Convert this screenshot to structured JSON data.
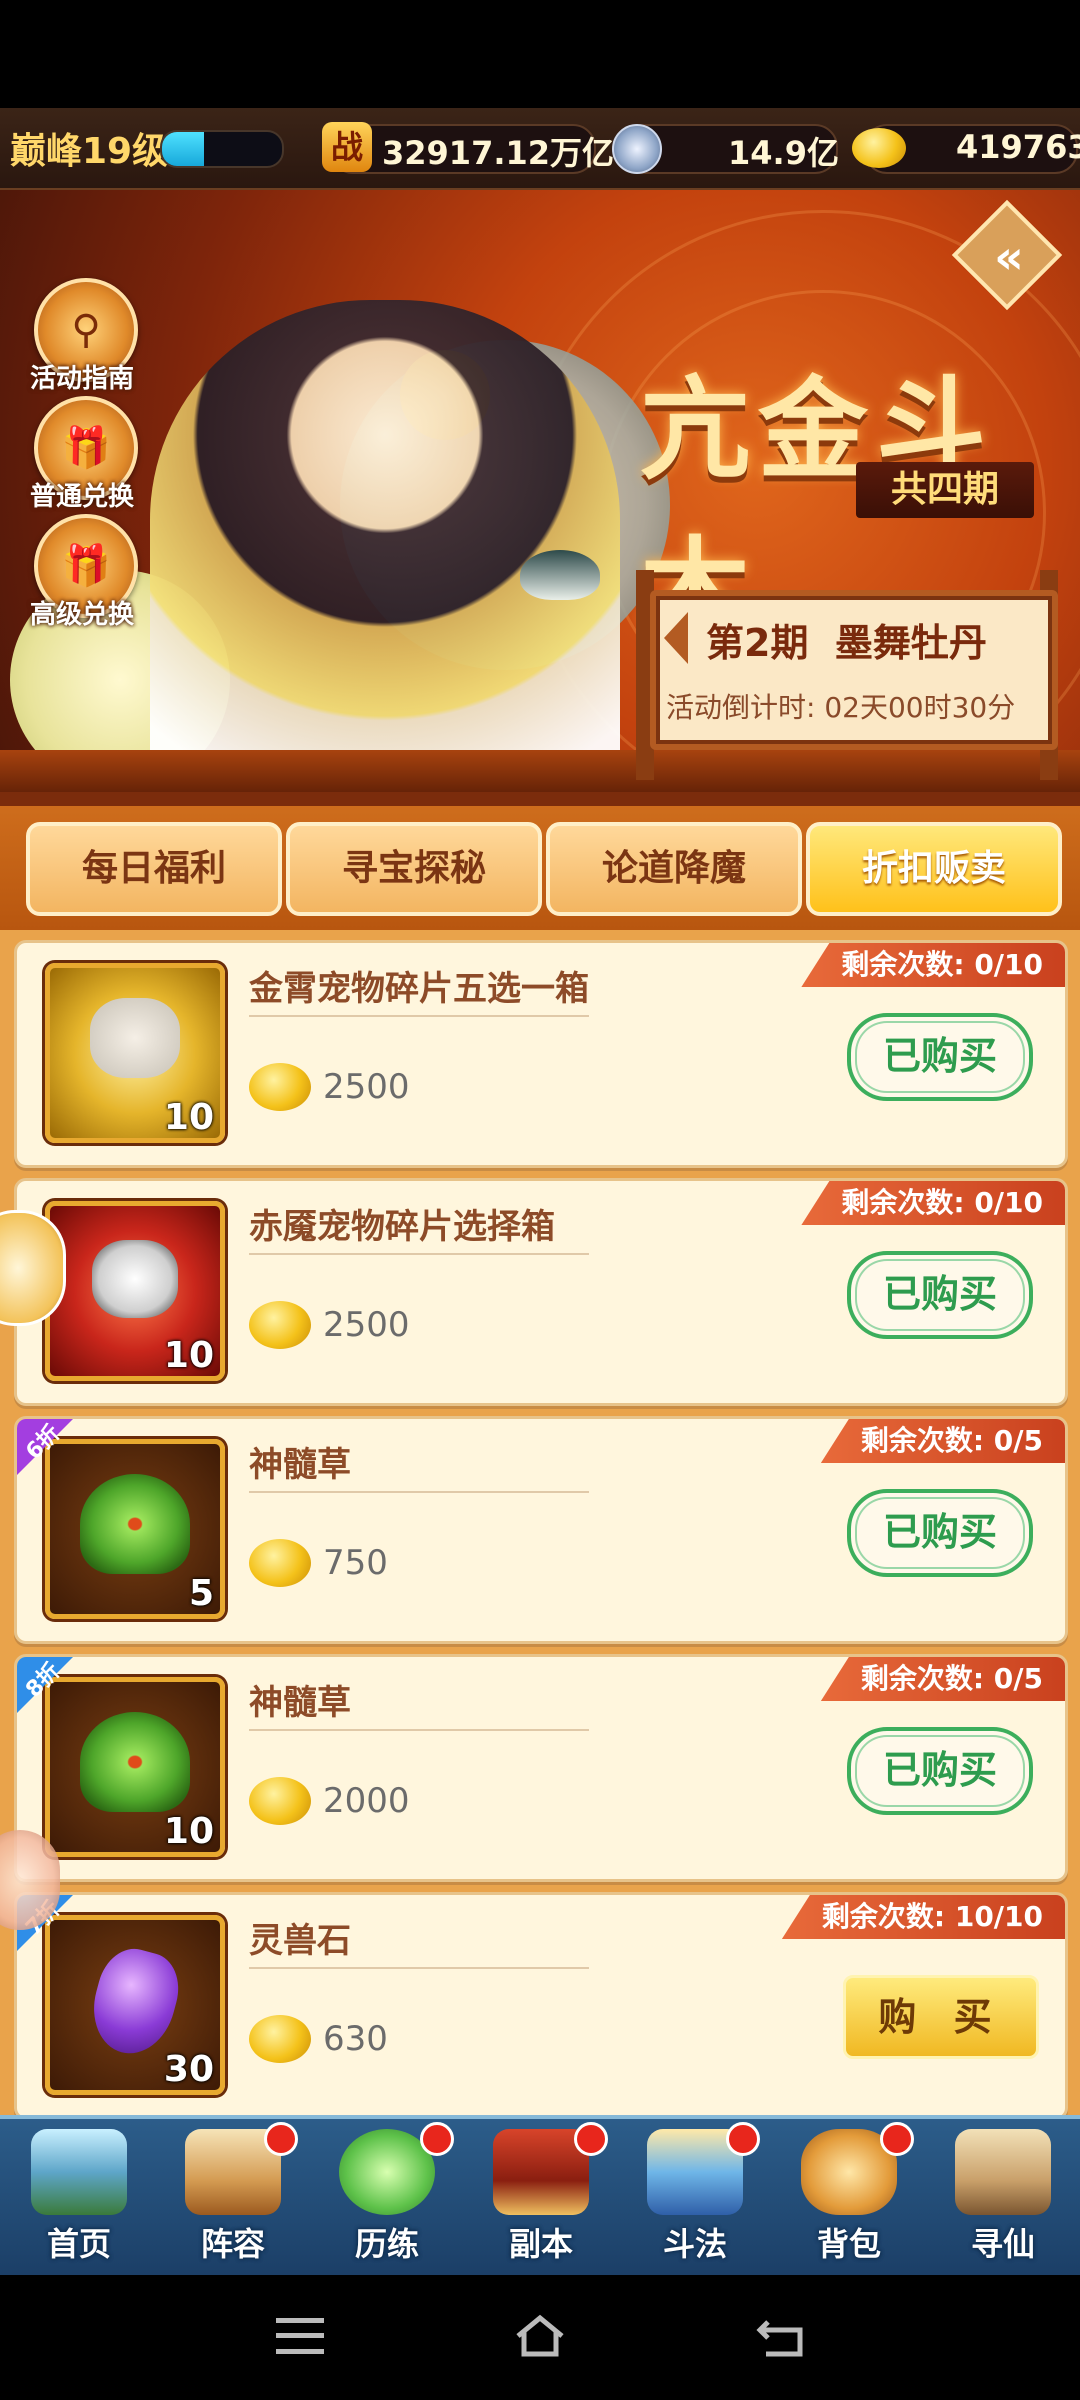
{
  "header": {
    "level": "巅峰19级",
    "exp_fraction": 0.35,
    "power": "32917.12万亿",
    "silver": "14.9亿",
    "gold": "419763"
  },
  "banner": {
    "title": "亢金斗木",
    "subtitle": "共四期",
    "phase": "第2期  墨舞牡丹",
    "countdown": "活动倒计时: 02天00时30分",
    "side_buttons": [
      {
        "label": "活动指南",
        "icon": "magnifier-icon"
      },
      {
        "label": "普通兑换",
        "icon": "giftbox-icon"
      },
      {
        "label": "高级兑换",
        "icon": "giftbox-icon"
      }
    ]
  },
  "tabs": [
    {
      "label": "每日福利"
    },
    {
      "label": "寻宝探秘"
    },
    {
      "label": "论道降魔"
    },
    {
      "label": "折扣贩卖"
    }
  ],
  "items": [
    {
      "name": "金霄宠物碎片五选一箱",
      "qty": "10",
      "price": "2500",
      "remaining": "剩余次数: 0/10",
      "button": "已购买",
      "discount": "",
      "icon": "gold-chest-icon"
    },
    {
      "name": "赤魇宠物碎片选择箱",
      "qty": "10",
      "price": "2500",
      "remaining": "剩余次数: 0/10",
      "button": "已购买",
      "discount": "",
      "icon": "red-chest-icon"
    },
    {
      "name": "神髓草",
      "qty": "5",
      "price": "750",
      "remaining": "剩余次数: 0/5",
      "button": "已购买",
      "discount": "6折",
      "icon": "herb-icon"
    },
    {
      "name": "神髓草",
      "qty": "10",
      "price": "2000",
      "remaining": "剩余次数: 0/5",
      "button": "已购买",
      "discount": "8折",
      "icon": "herb-icon"
    },
    {
      "name": "灵兽石",
      "qty": "30",
      "price": "630",
      "remaining": "剩余次数: 10/10",
      "button": "购 买",
      "discount": "7折",
      "icon": "purple-stone-icon"
    }
  ],
  "nav": [
    {
      "label": "首页",
      "icon": "mountain-home-icon"
    },
    {
      "label": "阵容",
      "icon": "cards-icon"
    },
    {
      "label": "历练",
      "icon": "snail-icon"
    },
    {
      "label": "副本",
      "icon": "gate-icon"
    },
    {
      "label": "斗法",
      "icon": "tower-icon"
    },
    {
      "label": "背包",
      "icon": "bag-icon"
    },
    {
      "label": "寻仙",
      "icon": "scroll-icon"
    }
  ],
  "colors": {
    "accent": "#e86a3a",
    "bought_green": "#2e9c4e",
    "tab_active": "#ffc11a"
  }
}
